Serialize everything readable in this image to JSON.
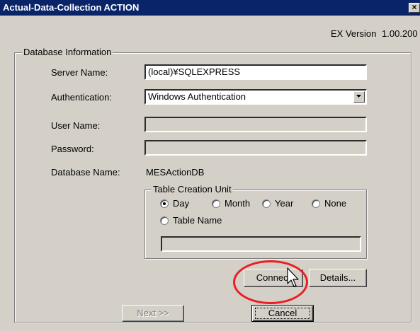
{
  "window": {
    "title": "Actual-Data-Collection ACTION",
    "close_glyph": "×"
  },
  "version": {
    "label": "EX Version",
    "value": "1.00.200"
  },
  "database_info": {
    "legend": "Database Information",
    "server_name_label": "Server Name:",
    "server_name_value": "(local)¥SQLEXPRESS",
    "authentication_label": "Authentication:",
    "authentication_value": "Windows Authentication",
    "user_name_label": "User Name:",
    "user_name_value": "",
    "password_label": "Password:",
    "password_value": "",
    "database_name_label": "Database Name:",
    "database_name_value": "MESActionDB"
  },
  "table_creation": {
    "legend": "Table Creation Unit",
    "options": [
      {
        "label": "Day",
        "selected": true
      },
      {
        "label": "Month",
        "selected": false
      },
      {
        "label": "Year",
        "selected": false
      },
      {
        "label": "None",
        "selected": false
      },
      {
        "label": "Table Name",
        "selected": false
      }
    ],
    "table_name_value": ""
  },
  "buttons": {
    "connect": "Connect",
    "details": "Details...",
    "next": "Next >>",
    "cancel": "Cancel"
  },
  "colors": {
    "titlebar": "#0a246a",
    "face": "#d4d0c8",
    "highlight_oval": "#ee1c24"
  },
  "icons": {
    "close": "close-icon",
    "dropdown": "chevron-down-icon",
    "cursor": "mouse-pointer-icon"
  }
}
